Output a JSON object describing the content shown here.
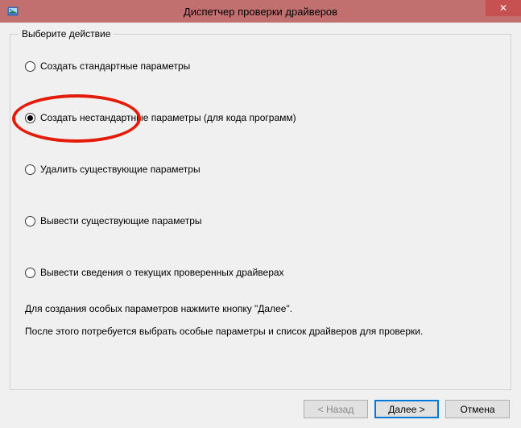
{
  "window": {
    "title": "Диспетчер проверки драйверов"
  },
  "groupbox": {
    "title": "Выберите действие"
  },
  "options": [
    {
      "label": "Создать стандартные параметры",
      "selected": false
    },
    {
      "label": "Создать нестандартные параметры (для кода программ)",
      "selected": true
    },
    {
      "label": "Удалить существующие параметры",
      "selected": false
    },
    {
      "label": "Вывести существующие параметры",
      "selected": false
    },
    {
      "label": "Вывести сведения о текущих проверенных драйверах",
      "selected": false
    }
  ],
  "info": {
    "line1": "Для создания особых параметров нажмите кнопку \"Далее\".",
    "line2": "После этого потребуется выбрать особые параметры и список драйверов для проверки."
  },
  "buttons": {
    "back": "< Назад",
    "next": "Далее >",
    "cancel": "Отмена"
  },
  "annotation": {
    "highlight_option_index": 1,
    "highlight_color": "#e31b09"
  }
}
